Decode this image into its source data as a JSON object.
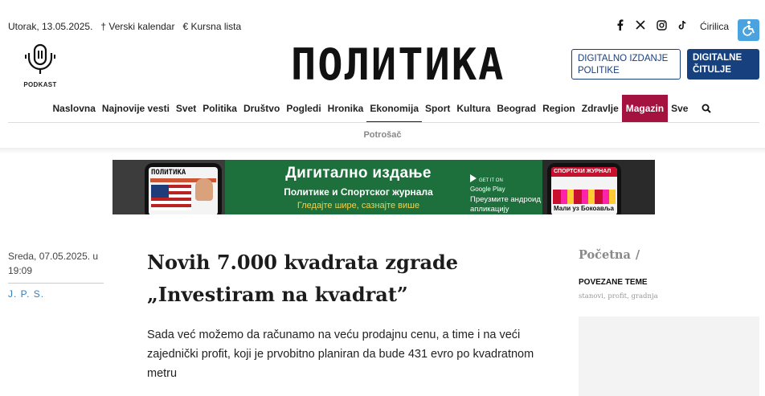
{
  "topbar": {
    "date": "Utorak, 13.05.2025.",
    "calendar": "† Verski kalendar",
    "currency": "€ Kursna lista",
    "social_icons": [
      "facebook-icon",
      "x-icon",
      "instagram-icon",
      "tiktok-icon"
    ],
    "script_toggle": "Ćirilica"
  },
  "header": {
    "podcast_label": "PODKAST",
    "logo_text": "ПОЛИТИКА",
    "digital_button": "DIGITALNO IZDANJE POLITIKE",
    "citulje_button": "DIGITALNE ČITULJE"
  },
  "nav": {
    "items": [
      {
        "label": "Naslovna"
      },
      {
        "label": "Najnovije vesti"
      },
      {
        "label": "Svet"
      },
      {
        "label": "Politika"
      },
      {
        "label": "Društvo"
      },
      {
        "label": "Pogledi"
      },
      {
        "label": "Hronika"
      },
      {
        "label": "Ekonomija"
      },
      {
        "label": "Sport"
      },
      {
        "label": "Kultura"
      },
      {
        "label": "Beograd"
      },
      {
        "label": "Region"
      },
      {
        "label": "Zdravlje"
      },
      {
        "label": "Magazin"
      },
      {
        "label": "Sve"
      }
    ],
    "active": "Ekonomija",
    "highlighted": "Magazin",
    "subnav": "Potrošač"
  },
  "banner": {
    "title": "Дигитално издање",
    "subtitle": "Политике и Спортског журнала",
    "tagline": "Гледајте шире, сазнајте више",
    "store_small": "GET IT ON",
    "store_big": "Google Play",
    "store_desc": "Преузмите андроид апликацију",
    "phone_left_logo": "ПОЛИТИКА",
    "phone_right_logo": "СПОРТСКИ ЖУРНАЛ",
    "phone_right_caption": "Мали уз Бокоавља"
  },
  "article": {
    "date": "Sreda, 07.05.2025. u 19:09",
    "author": "J. P. S.",
    "title": "Novih 7.000 kvadrata zgrade „Investiram na kvadrat”",
    "lead": "Sada već možemo da računamo na veću prodajnu cenu, a time i na veći zajednički profit, koji je prvobitno planiran da bude 431 evro po kvadratnom metru"
  },
  "sidebar": {
    "breadcrumb": "Početna",
    "breadcrumb_sep": "/",
    "related_title": "POVEZANE TEME",
    "related_tags": "stanovi, profit, gradnja"
  },
  "colors": {
    "nav_highlight": "#a4123f",
    "button_blue": "#17407e",
    "accessibility": "#4aa3df",
    "banner_green": "#1d6f3c"
  }
}
